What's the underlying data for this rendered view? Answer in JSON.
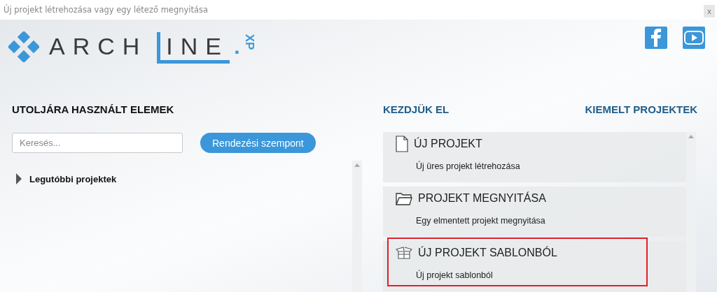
{
  "window": {
    "title": "Új projekt létrehozása vagy egy létező megnyitása",
    "close": "x"
  },
  "logo": {
    "left": "ARCH",
    "right": "INE",
    "dot": ".",
    "suffix": "XP"
  },
  "social": [
    {
      "kind": "facebook"
    },
    {
      "kind": "youtube"
    }
  ],
  "recent": {
    "heading": "UTOLJÁRA HASZNÁLT ELEMEK",
    "search": {
      "placeholder": "Keresés..."
    },
    "sort_button": "Rendezési szempont",
    "groups": [
      {
        "label": "Legutóbbi projektek",
        "expanded": false
      }
    ]
  },
  "start": {
    "heading": "KEZDJÜK EL",
    "featured_link": "KIEMELT PROJEKTEK",
    "cards": [
      {
        "kind": "new",
        "title": "ÚJ PROJEKT",
        "subtitle": "Új üres projekt létrehozása",
        "highlighted": false
      },
      {
        "kind": "open",
        "title": "PROJEKT MEGNYITÁSA",
        "subtitle": "Egy elmentett projekt megnyitása",
        "highlighted": false
      },
      {
        "kind": "template",
        "title": "ÚJ PROJEKT SABLONBÓL",
        "subtitle": "Új projekt sablonból",
        "highlighted": true
      }
    ]
  }
}
